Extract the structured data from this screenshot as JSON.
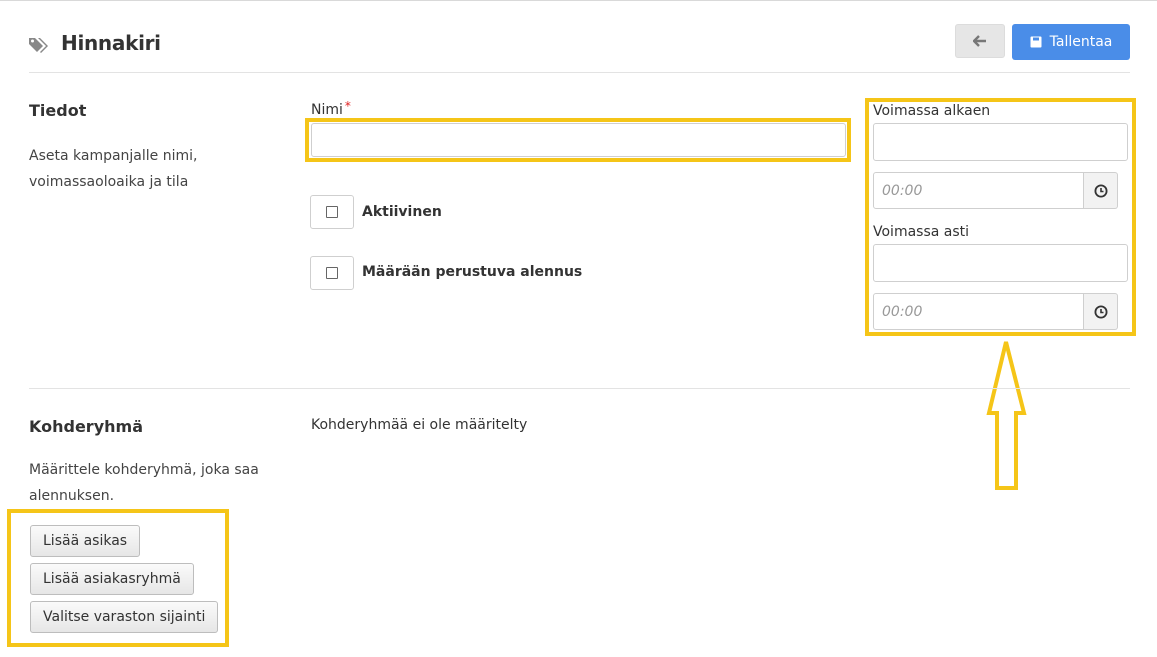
{
  "header": {
    "title": "Hinnakiri",
    "save_label": "Tallentaa"
  },
  "tiedot": {
    "title": "Tiedot",
    "description": "Aseta kampanjalle nimi, voimassaoloaika ja tila",
    "name_label": "Nimi",
    "name_required_mark": "*",
    "name_value": "",
    "active_label": "Aktiivinen",
    "quantity_discount_label": "Määrään perustuva alennus",
    "valid_from_label": "Voimassa alkaen",
    "valid_from_date": "",
    "valid_from_time_placeholder": "00:00",
    "valid_to_label": "Voimassa asti",
    "valid_to_date": "",
    "valid_to_time_placeholder": "00:00"
  },
  "kohderyhma": {
    "title": "Kohderyhmä",
    "description": "Määrittele kohderyhmä, joka saa alennuksen.",
    "empty_text": "Kohderyhmää ei ole määritelty",
    "buttons": [
      "Lisää asikas",
      "Lisää asiakasryhmä",
      "Valitse varaston sijainti"
    ]
  },
  "colors": {
    "accent": "#4a8de8",
    "highlight": "#f5c518"
  },
  "icons": [
    "tags-icon",
    "arrow-left-icon",
    "save-icon",
    "clock-icon",
    "checkbox-icon",
    "up-arrow-annotation"
  ]
}
